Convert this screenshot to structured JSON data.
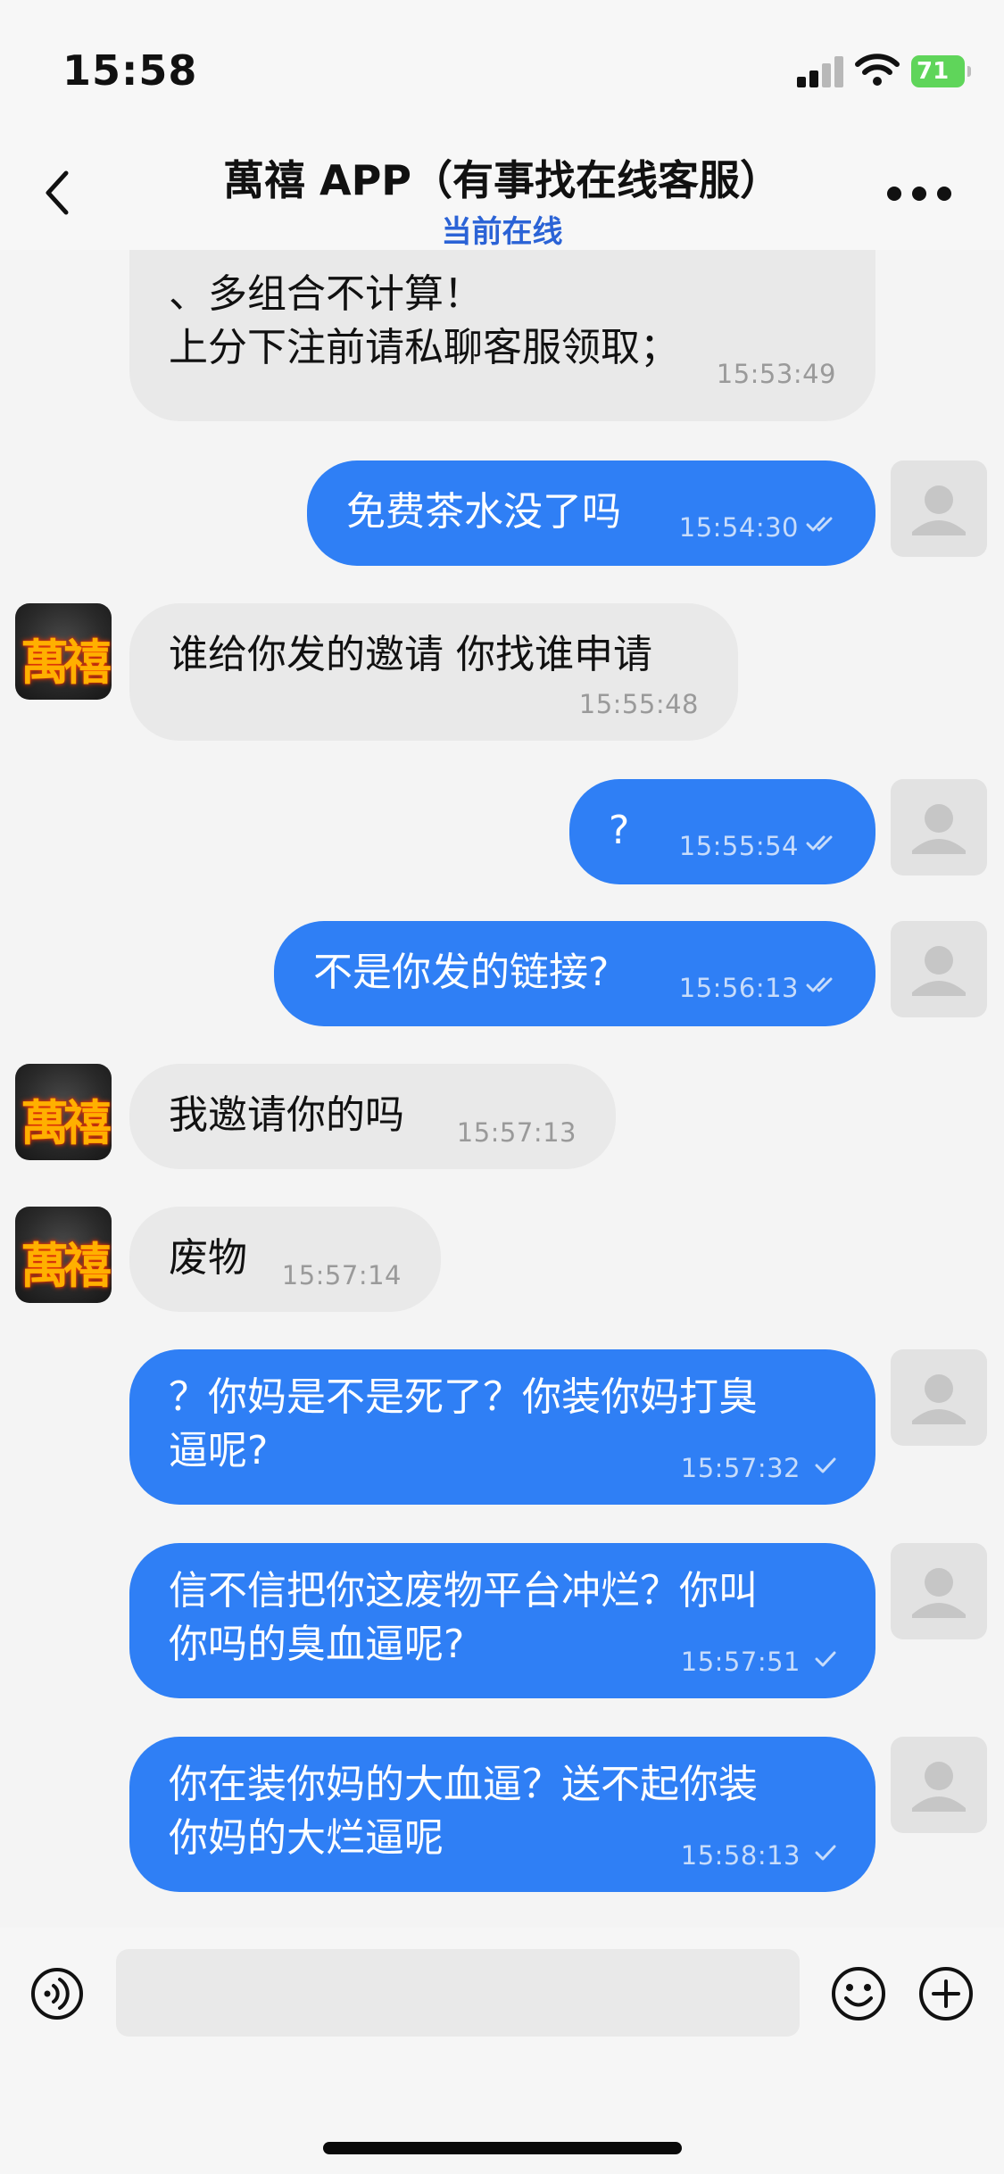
{
  "status_bar": {
    "time": "15:58",
    "battery": "71"
  },
  "header": {
    "title": "萬禧 APP（有事找在线客服）",
    "subtitle": "当前在线"
  },
  "agent": {
    "avatar_text": "萬禧"
  },
  "messages": [
    {
      "side": "in",
      "avatar": false,
      "text": "、多组合不计算！\n上分下注前请私聊客服领取；",
      "time": "15:53:49"
    },
    {
      "side": "out",
      "text": "免费茶水没了吗",
      "time": "15:54:30",
      "status": "read"
    },
    {
      "side": "in",
      "avatar": true,
      "text": "谁给你发的邀请 你找谁申请",
      "time": "15:55:48"
    },
    {
      "side": "out",
      "text": "?",
      "time": "15:55:54",
      "status": "read"
    },
    {
      "side": "out",
      "text": "不是你发的链接?",
      "time": "15:56:13",
      "status": "read"
    },
    {
      "side": "in",
      "avatar": true,
      "text": "我邀请你的吗",
      "time": "15:57:13"
    },
    {
      "side": "in",
      "avatar": true,
      "text": "废物",
      "time": "15:57:14"
    },
    {
      "side": "out",
      "text": "？你妈是不是死了？你装你妈打臭\n逼呢?",
      "time": "15:57:32",
      "status": "sent"
    },
    {
      "side": "out",
      "text": "信不信把你这废物平台冲烂？你叫\n你吗的臭血逼呢?",
      "time": "15:57:51",
      "status": "sent"
    },
    {
      "side": "out",
      "text": "你在装你妈的大血逼？送不起你装\n你妈的大烂逼呢",
      "time": "15:58:13",
      "status": "sent"
    }
  ],
  "input": {
    "placeholder": ""
  },
  "icons": {
    "back": "chevron-left-icon",
    "more": "more-dots-icon",
    "voice": "voice-icon",
    "emoji": "emoji-icon",
    "plus": "plus-icon",
    "read": "double-check-icon",
    "sent": "check-icon"
  }
}
